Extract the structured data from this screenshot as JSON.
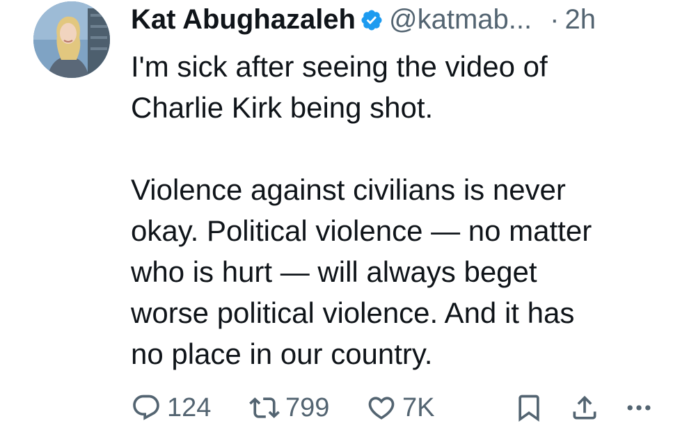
{
  "tweet": {
    "author": {
      "display_name": "Kat Abughazaleh",
      "handle": "@katmab...",
      "verified": true
    },
    "separator": "·",
    "time": "2h",
    "paragraphs": [
      [
        "I'm sick after seeing the video of",
        "Charlie Kirk being shot."
      ],
      [
        "Violence against civilians is never",
        "okay. Political violence — no matter",
        "who is hurt — will always beget",
        "worse political violence. And it has",
        "no place in our country."
      ]
    ],
    "actions": {
      "reply": {
        "icon": "reply-icon",
        "count": "124"
      },
      "retweet": {
        "icon": "retweet-icon",
        "count": "799"
      },
      "like": {
        "icon": "heart-icon",
        "count": "7K"
      },
      "bookmark": {
        "icon": "bookmark-icon"
      },
      "share": {
        "icon": "share-icon"
      },
      "more": {
        "icon": "more-icon"
      }
    },
    "colors": {
      "text": "#0f1419",
      "secondary": "#536471",
      "verified": "#1d9bf0"
    }
  }
}
